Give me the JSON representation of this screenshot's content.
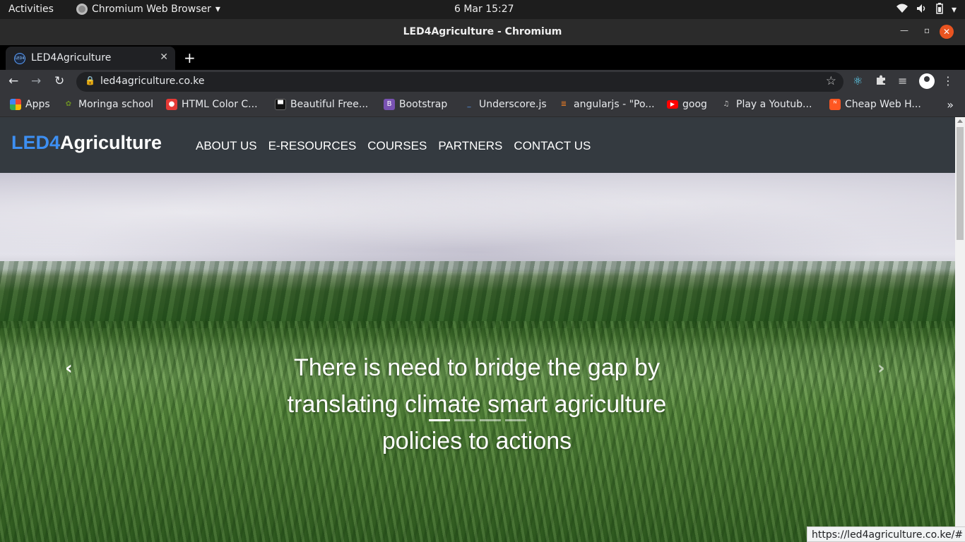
{
  "system": {
    "activities": "Activities",
    "app_name": "Chromium Web Browser",
    "clock": "6 Mar  15:27"
  },
  "window": {
    "title": "LED4Agriculture - Chromium"
  },
  "tabs": [
    {
      "label": "LED4Agriculture",
      "favicon_text": "LED4"
    }
  ],
  "toolbar": {
    "url": "led4agriculture.co.ke"
  },
  "bookmarks": [
    {
      "label": "Apps",
      "icon": "apps-grid-icon",
      "color": "#4285f4"
    },
    {
      "label": "Moringa school",
      "icon": "moringa-icon",
      "color": "#6b8e23"
    },
    {
      "label": "HTML Color C...",
      "icon": "html-color-icon",
      "color": "#e53935"
    },
    {
      "label": "Beautiful Free...",
      "icon": "unsplash-icon",
      "color": "#111111"
    },
    {
      "label": "Bootstrap",
      "icon": "bootstrap-icon",
      "color": "#7952b3"
    },
    {
      "label": "Underscore.js",
      "icon": "underscore-icon",
      "color": "#1e4d8c"
    },
    {
      "label": "angularjs - \"Po...",
      "icon": "stackoverflow-icon",
      "color": "#f48024"
    },
    {
      "label": "goog",
      "icon": "youtube-icon",
      "color": "#ff0000"
    },
    {
      "label": "Play a Youtub...",
      "icon": "music-note-icon",
      "color": "#888888"
    },
    {
      "label": "Cheap Web H...",
      "icon": "webhost-icon",
      "color": "#ff5722"
    }
  ],
  "site": {
    "brand_led": "LED4",
    "brand_agri": "Agriculture",
    "nav": [
      "ABOUT US",
      "E-RESOURCES",
      "COURSES",
      "PARTNERS",
      "CONTACT US"
    ],
    "hero_caption": "There is need to bridge the gap by translating climate smart agriculture policies to actions",
    "carousel_active_index": 0,
    "carousel_slides": 4
  },
  "status_url": "https://led4agriculture.co.ke/#"
}
